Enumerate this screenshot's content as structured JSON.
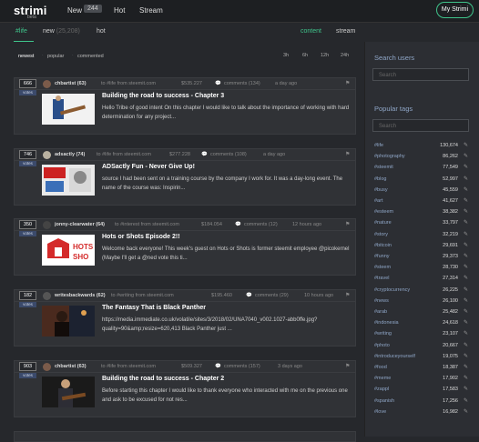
{
  "header": {
    "logo": "strimi",
    "logo_sub": "beta",
    "nav_new": "New",
    "nav_new_count": "244",
    "nav_hot": "Hot",
    "nav_stream": "Stream",
    "my_strimi": "My Strimi"
  },
  "subnav": {
    "tag": "#life",
    "new_label": "new",
    "new_count": "(25,208)",
    "hot": "hot",
    "content": "content",
    "stream": "stream"
  },
  "sort": {
    "newest": "newest",
    "popular": "popular",
    "commented": "commented",
    "sep": "·",
    "times": [
      "3h",
      "6h",
      "12h",
      "24h"
    ]
  },
  "posts": [
    {
      "votes": "666",
      "votes_label": "votes",
      "author": "chbartist (63)",
      "source": "to #life from steemit.com",
      "amount": "$535.227",
      "comments": "comments (134)",
      "time": "a day ago",
      "title": "Building the road to success - Chapter 3",
      "body": "Hello Tribe of good intent On this chapter I would like to talk about the importance of working with hard determination for any project..."
    },
    {
      "votes": "746",
      "votes_label": "votes",
      "author": "adsactly (74)",
      "source": "to #life from steemit.com",
      "amount": "$277.228",
      "comments": "comments (108)",
      "time": "a day ago",
      "title": "ADSactly Fun - Never Give Up!",
      "body": "source I had been sent on a training course by the company I work for. It was a day-long event. The name of the course was: Inspirin..."
    },
    {
      "votes": "350",
      "votes_label": "votes",
      "author": "jonny-clearwater (64)",
      "source": "to #interest from steemit.com",
      "amount": "$184.054",
      "comments": "comments (12)",
      "time": "12 hours ago",
      "title": "Hots or Shots Episode 2!!",
      "body": "Welcome back everyone! This week's guest on Hots or Shots is former steemit employee @picokernel (Maybe I'll get a @ned vote this ti..."
    },
    {
      "votes": "182",
      "votes_label": "votes",
      "author": "writesbackwards (62)",
      "source": "to #writing from steemit.com",
      "amount": "$195.460",
      "comments": "comments (29)",
      "time": "10 hours ago",
      "title": "The Fantasy That is Black Panther",
      "body": "https://media.immediate.co.uk/volatile/sites/3/2018/02/UNA7040_v002.1027-abb0ffe.jpg?quality=90&amp;resize=620,413 Black Panther just ..."
    },
    {
      "votes": "903",
      "votes_label": "votes",
      "author": "chbartist (63)",
      "source": "to #life from steemit.com",
      "amount": "$509.327",
      "comments": "comments (157)",
      "time": "3 days ago",
      "title": "Building the road to success - Chapter 2",
      "body": "Before starting this chapter I would like to thank everyone who interacted with me on the previous one and ask to be excused for not res..."
    }
  ],
  "sidebar": {
    "search_users_title": "Search users",
    "search_users_placeholder": "Search",
    "popular_tags_title": "Popular tags",
    "search_tags_placeholder": "Search",
    "tags": [
      {
        "name": "#life",
        "count": "130,674"
      },
      {
        "name": "#photography",
        "count": "86,262"
      },
      {
        "name": "#steemit",
        "count": "77,549"
      },
      {
        "name": "#blog",
        "count": "52,997"
      },
      {
        "name": "#busy",
        "count": "45,559"
      },
      {
        "name": "#art",
        "count": "41,627"
      },
      {
        "name": "#esteem",
        "count": "38,382"
      },
      {
        "name": "#nature",
        "count": "33,797"
      },
      {
        "name": "#story",
        "count": "32,219"
      },
      {
        "name": "#bitcoin",
        "count": "29,691"
      },
      {
        "name": "#funny",
        "count": "29,373"
      },
      {
        "name": "#steem",
        "count": "28,730"
      },
      {
        "name": "#travel",
        "count": "27,314"
      },
      {
        "name": "#cryptocurrency",
        "count": "26,225"
      },
      {
        "name": "#news",
        "count": "26,100"
      },
      {
        "name": "#arab",
        "count": "25,482"
      },
      {
        "name": "#indonesia",
        "count": "24,618"
      },
      {
        "name": "#writing",
        "count": "23,107"
      },
      {
        "name": "#photo",
        "count": "20,667"
      },
      {
        "name": "#introduceyourself",
        "count": "19,075"
      },
      {
        "name": "#food",
        "count": "18,387"
      },
      {
        "name": "#meme",
        "count": "17,902"
      },
      {
        "name": "#zappl",
        "count": "17,583"
      },
      {
        "name": "#spanish",
        "count": "17,256"
      },
      {
        "name": "#love",
        "count": "16,982"
      }
    ]
  },
  "icons": {
    "comment": "comment-icon",
    "flag": "flag-icon",
    "edit": "edit-icon"
  },
  "colors": {
    "accent": "#3fc48b",
    "background": "#26282c",
    "card": "#303236",
    "tag_link": "#8fa6c7"
  }
}
